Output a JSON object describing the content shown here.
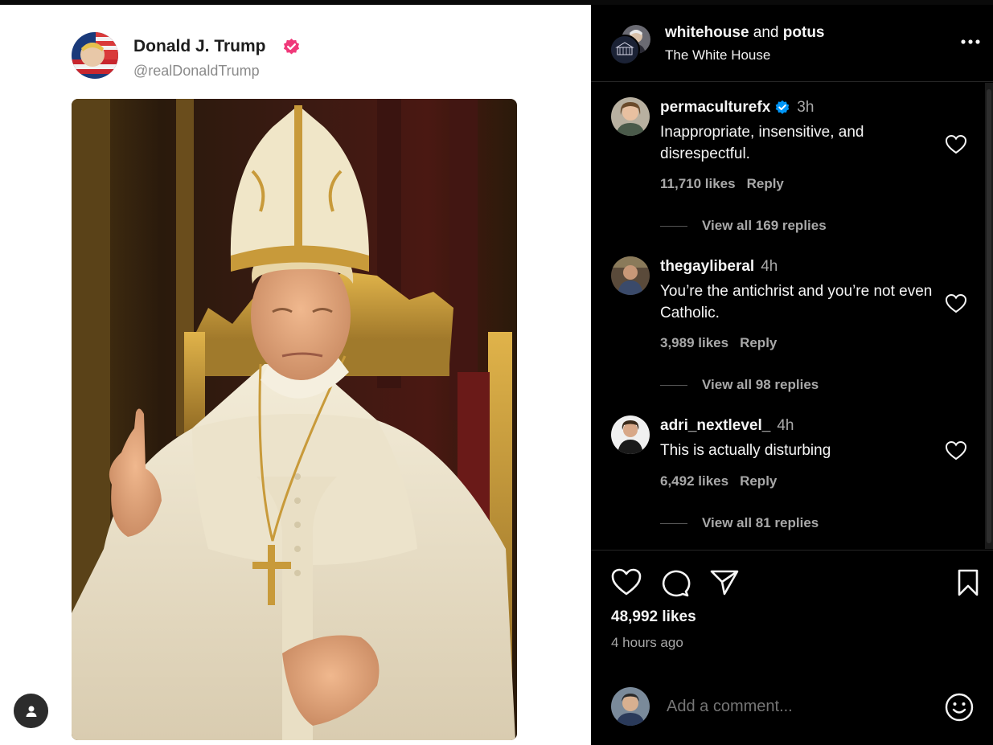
{
  "post": {
    "author_name": "Donald J. Trump",
    "author_handle": "@realDonaldTrump"
  },
  "header": {
    "account1": "whitehouse",
    "joiner": "and",
    "account2": "potus",
    "subtitle": "The White House"
  },
  "comments": [
    {
      "username": "permaculturefx",
      "verified": true,
      "time": "3h",
      "text": "Inappropriate, insensitive, and disrespectful.",
      "likes": "11,710 likes",
      "reply_label": "Reply",
      "replies": "View all 169 replies"
    },
    {
      "username": "thegayliberal",
      "verified": false,
      "time": "4h",
      "text": "You’re the antichrist and you’re not even Catholic.",
      "likes": "3,989 likes",
      "reply_label": "Reply",
      "replies": "View all 98 replies"
    },
    {
      "username": "adri_nextlevel_",
      "verified": false,
      "time": "4h",
      "text": "This is actually disturbing",
      "likes": "6,492 likes",
      "reply_label": "Reply",
      "replies": "View all 81 replies"
    }
  ],
  "footer": {
    "likes": "48,992 likes",
    "time_ago": "4 hours ago",
    "comment_placeholder": "Add a comment..."
  },
  "icons": {
    "more": "more-horizontal-icon",
    "like": "heart-icon",
    "comment": "comment-icon",
    "share": "send-icon",
    "save": "bookmark-icon",
    "emoji": "emoji-icon",
    "verified": "verified-badge-icon",
    "user": "user-icon"
  },
  "colors": {
    "verified_blue": "#0095f6",
    "verified_pink": "#f0397a",
    "panel_bg": "#000000",
    "muted_text": "#a8a8a8"
  }
}
